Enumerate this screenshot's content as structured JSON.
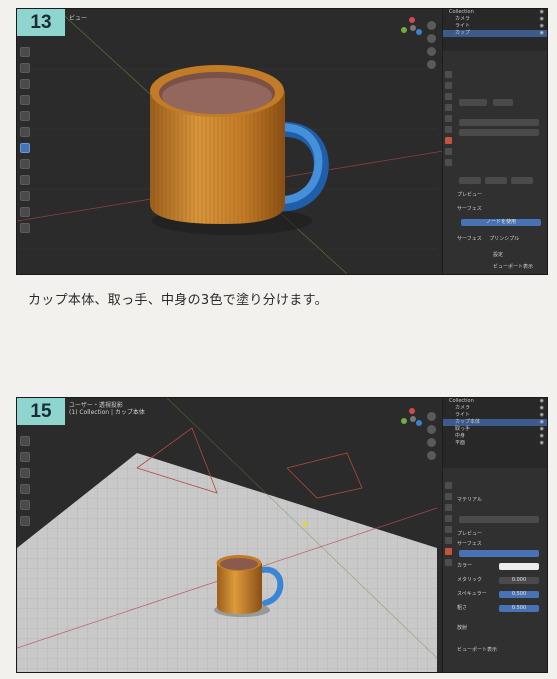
{
  "step1": {
    "badge": "13",
    "viewport_title": "ビュー",
    "outliner": [
      {
        "label": "Collection",
        "selected": false
      },
      {
        "label": "カメラ",
        "selected": false
      },
      {
        "label": "ライト",
        "selected": false
      },
      {
        "label": "カップ",
        "selected": true
      }
    ],
    "props": {
      "surface_label": "サーフェス",
      "preview_label": "プレビュー",
      "use_nodes_button": "ノードを使用",
      "surface_field": "サーフェス",
      "principled": "プリンシプル",
      "extra1": "設定",
      "extra2": "ビューポート表示"
    }
  },
  "caption": "カップ本体、取っ手、中身の3色で塗り分けます。",
  "step2": {
    "badge": "15",
    "viewport_line1": "ユーザー・透視投影",
    "viewport_line2": "(1) Collection | カップ本体",
    "outliner": [
      {
        "label": "Collection",
        "selected": false
      },
      {
        "label": "カメラ",
        "selected": false
      },
      {
        "label": "ライト",
        "selected": false
      },
      {
        "label": "カップ本体",
        "selected": true
      },
      {
        "label": "取っ手",
        "selected": false
      },
      {
        "label": "中身",
        "selected": false
      },
      {
        "label": "平面",
        "selected": false
      }
    ],
    "props": {
      "material_name": "マテリアル",
      "preview_label": "プレビュー",
      "surface_label": "サーフェス",
      "color_label": "カラー",
      "metallic_label": "メタリック",
      "roughness_label": "粗さ",
      "metallic_value": "0.000",
      "roughness_value": "0.500",
      "specular_label": "スペキュラー",
      "specular_value": "0.500",
      "emission_label": "放射",
      "options_label": "ビューポート表示"
    }
  },
  "colors": {
    "cup_body": "#c9862e",
    "cup_handle": "#3a86d4",
    "cup_content": "#8a5a4e",
    "badge": "#8fd5cf",
    "viewport_bg": "#2b2b2b",
    "floor": "#c7c7c7"
  },
  "icons": [
    "move-icon",
    "rotate-icon",
    "scale-icon",
    "cursor-icon",
    "annotate-icon",
    "measure-icon",
    "navigation-gizmo-icon",
    "zoom-icon",
    "hand-icon",
    "camera-icon"
  ]
}
